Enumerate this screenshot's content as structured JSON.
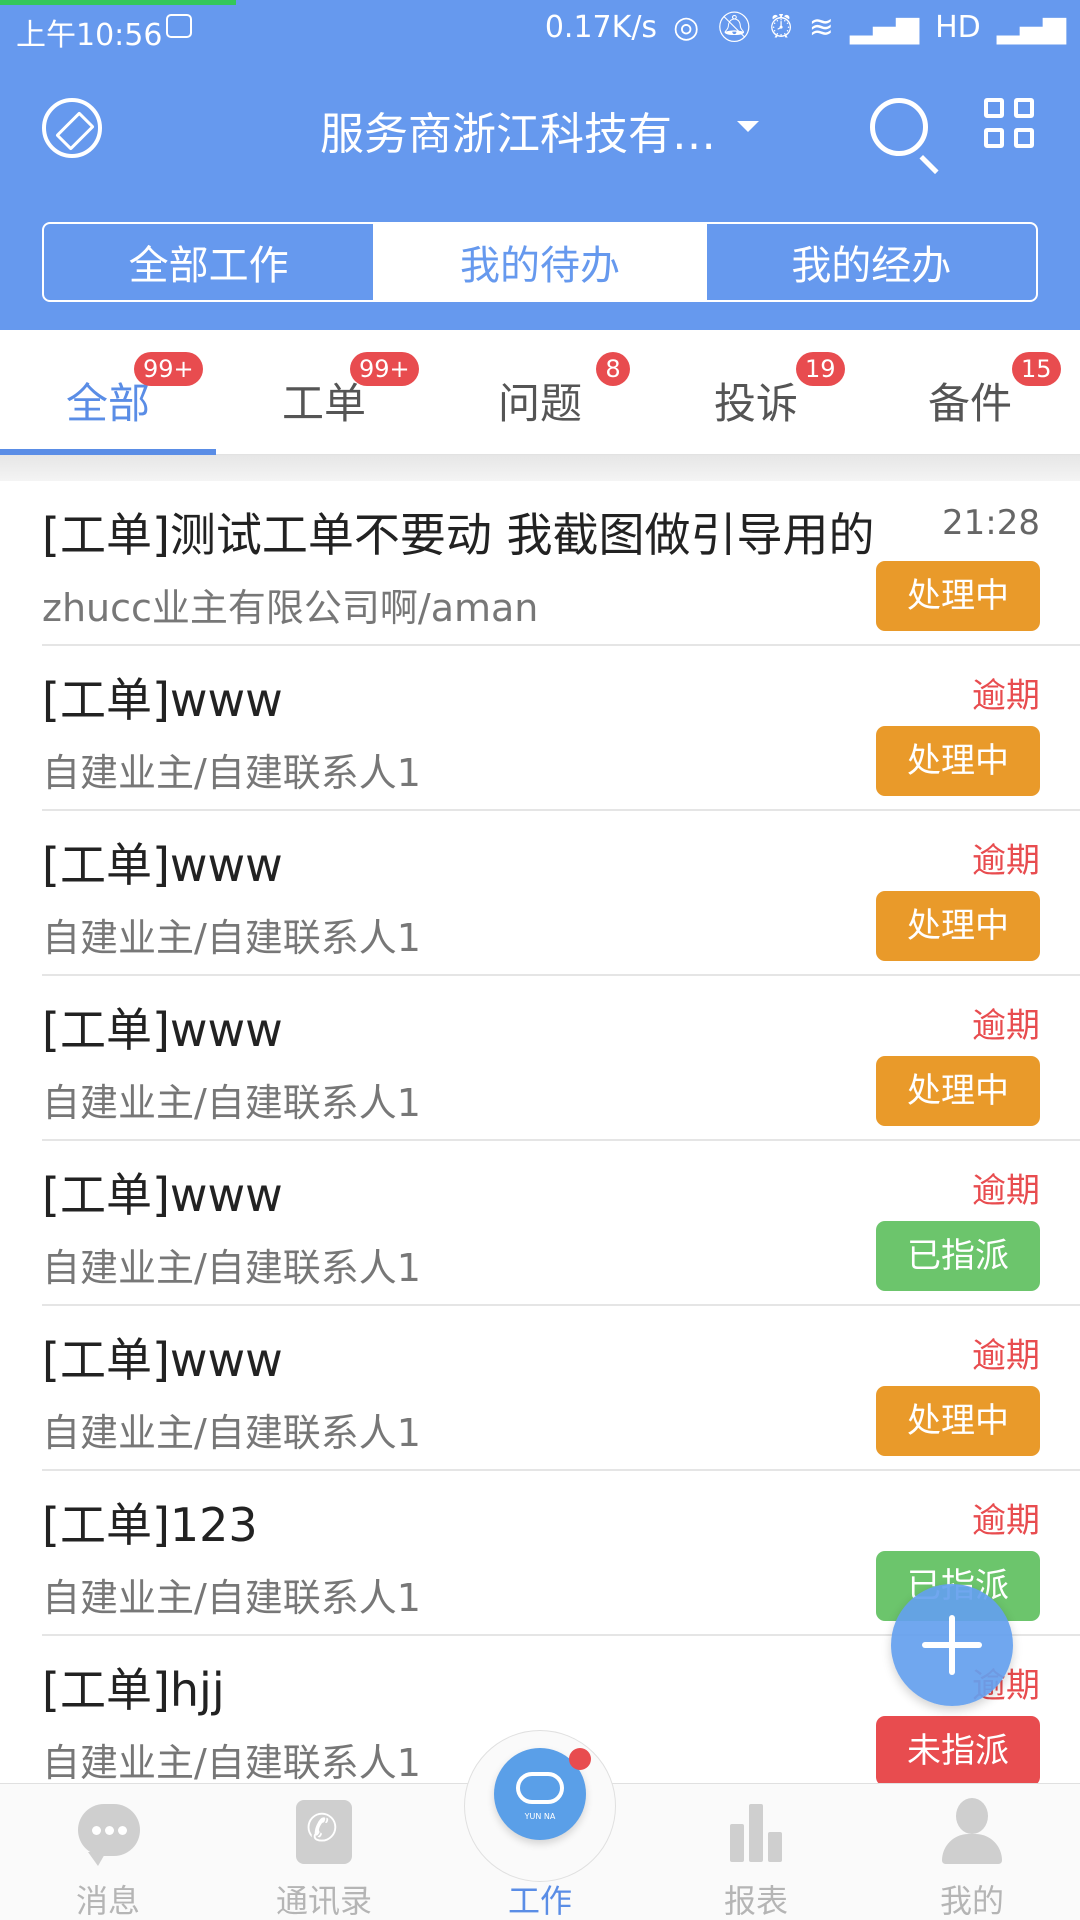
{
  "status_bar": {
    "time": "上午10:56",
    "net_speed": "0.17K/s",
    "network_label": "HD",
    "icons": [
      "cloud-notification-icon",
      "hotspot-icon",
      "mute-icon",
      "alarm-icon",
      "wifi-icon",
      "signal-icon",
      "signal-icon-2"
    ]
  },
  "header": {
    "title": "服务商浙江科技有…",
    "icons": [
      "compass-icon",
      "caret-down-icon",
      "search-icon",
      "grid-icon"
    ]
  },
  "segments": [
    {
      "label": "全部工作",
      "active": false
    },
    {
      "label": "我的待办",
      "active": true
    },
    {
      "label": "我的经办",
      "active": false
    }
  ],
  "filter_tabs": [
    {
      "label": "全部",
      "badge": "99+",
      "active": true
    },
    {
      "label": "工单",
      "badge": "99+",
      "active": false
    },
    {
      "label": "问题",
      "badge": "8",
      "active": false
    },
    {
      "label": "投诉",
      "badge": "19",
      "active": false
    },
    {
      "label": "备件",
      "badge": "15",
      "active": false
    }
  ],
  "colors": {
    "brand": "#6699ee",
    "accent": "#5a8de6",
    "processing": "#e99a2a",
    "assigned": "#6cc56c",
    "unassigned": "#e84c4f",
    "overdue": "#e84c4f"
  },
  "items": [
    {
      "title": "[工单]测试工单不要动  我截图做引导用的",
      "subtitle": "zhucc业主有限公司啊/aman",
      "right_text": "21:28",
      "right_type": "time",
      "status": "处理中",
      "status_color": "#e99a2a"
    },
    {
      "title": "[工单]www",
      "subtitle": "自建业主/自建联系人1",
      "right_text": "逾期",
      "right_type": "overdue",
      "status": "处理中",
      "status_color": "#e99a2a"
    },
    {
      "title": "[工单]www",
      "subtitle": "自建业主/自建联系人1",
      "right_text": "逾期",
      "right_type": "overdue",
      "status": "处理中",
      "status_color": "#e99a2a"
    },
    {
      "title": "[工单]www",
      "subtitle": "自建业主/自建联系人1",
      "right_text": "逾期",
      "right_type": "overdue",
      "status": "处理中",
      "status_color": "#e99a2a"
    },
    {
      "title": "[工单]www",
      "subtitle": "自建业主/自建联系人1",
      "right_text": "逾期",
      "right_type": "overdue",
      "status": "已指派",
      "status_color": "#6cc56c"
    },
    {
      "title": "[工单]www",
      "subtitle": "自建业主/自建联系人1",
      "right_text": "逾期",
      "right_type": "overdue",
      "status": "处理中",
      "status_color": "#e99a2a"
    },
    {
      "title": "[工单]123",
      "subtitle": "自建业主/自建联系人1",
      "right_text": "逾期",
      "right_type": "overdue",
      "status": "已指派",
      "status_color": "#6cc56c"
    },
    {
      "title": "[工单]hjj",
      "subtitle": "自建业主/自建联系人1",
      "right_text": "逾期",
      "right_type": "overdue",
      "status": "未指派",
      "status_color": "#e84c4f"
    }
  ],
  "fab": {
    "icon": "plus-icon"
  },
  "bottom_nav": [
    {
      "label": "消息",
      "icon": "message-icon",
      "active": false
    },
    {
      "label": "通讯录",
      "icon": "contacts-icon",
      "active": false
    },
    {
      "label": "工作",
      "icon": "cloud-work-icon",
      "logo_text": "YUN NA",
      "active": true
    },
    {
      "label": "报表",
      "icon": "report-chart-icon",
      "active": false
    },
    {
      "label": "我的",
      "icon": "user-icon",
      "active": false
    }
  ]
}
